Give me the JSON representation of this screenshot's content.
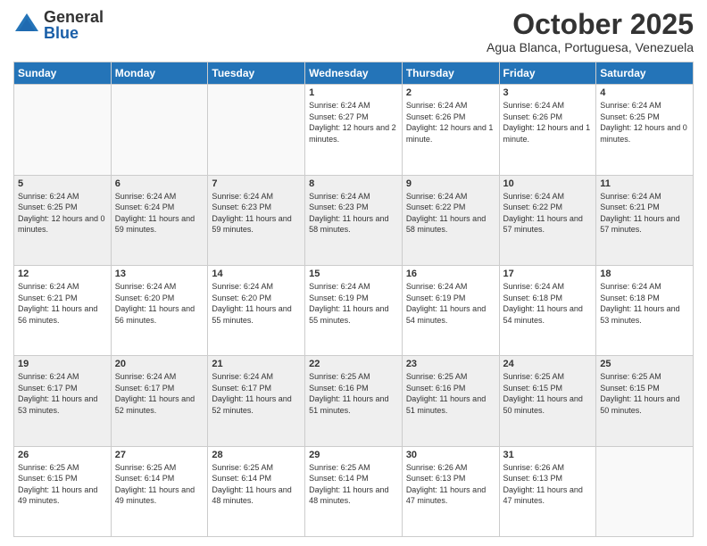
{
  "logo": {
    "general": "General",
    "blue": "Blue"
  },
  "header": {
    "month": "October 2025",
    "location": "Agua Blanca, Portuguesa, Venezuela"
  },
  "weekdays": [
    "Sunday",
    "Monday",
    "Tuesday",
    "Wednesday",
    "Thursday",
    "Friday",
    "Saturday"
  ],
  "weeks": [
    [
      {
        "day": "",
        "sunrise": "",
        "sunset": "",
        "daylight": ""
      },
      {
        "day": "",
        "sunrise": "",
        "sunset": "",
        "daylight": ""
      },
      {
        "day": "",
        "sunrise": "",
        "sunset": "",
        "daylight": ""
      },
      {
        "day": "1",
        "sunrise": "Sunrise: 6:24 AM",
        "sunset": "Sunset: 6:27 PM",
        "daylight": "Daylight: 12 hours and 2 minutes."
      },
      {
        "day": "2",
        "sunrise": "Sunrise: 6:24 AM",
        "sunset": "Sunset: 6:26 PM",
        "daylight": "Daylight: 12 hours and 1 minute."
      },
      {
        "day": "3",
        "sunrise": "Sunrise: 6:24 AM",
        "sunset": "Sunset: 6:26 PM",
        "daylight": "Daylight: 12 hours and 1 minute."
      },
      {
        "day": "4",
        "sunrise": "Sunrise: 6:24 AM",
        "sunset": "Sunset: 6:25 PM",
        "daylight": "Daylight: 12 hours and 0 minutes."
      }
    ],
    [
      {
        "day": "5",
        "sunrise": "Sunrise: 6:24 AM",
        "sunset": "Sunset: 6:25 PM",
        "daylight": "Daylight: 12 hours and 0 minutes."
      },
      {
        "day": "6",
        "sunrise": "Sunrise: 6:24 AM",
        "sunset": "Sunset: 6:24 PM",
        "daylight": "Daylight: 11 hours and 59 minutes."
      },
      {
        "day": "7",
        "sunrise": "Sunrise: 6:24 AM",
        "sunset": "Sunset: 6:23 PM",
        "daylight": "Daylight: 11 hours and 59 minutes."
      },
      {
        "day": "8",
        "sunrise": "Sunrise: 6:24 AM",
        "sunset": "Sunset: 6:23 PM",
        "daylight": "Daylight: 11 hours and 58 minutes."
      },
      {
        "day": "9",
        "sunrise": "Sunrise: 6:24 AM",
        "sunset": "Sunset: 6:22 PM",
        "daylight": "Daylight: 11 hours and 58 minutes."
      },
      {
        "day": "10",
        "sunrise": "Sunrise: 6:24 AM",
        "sunset": "Sunset: 6:22 PM",
        "daylight": "Daylight: 11 hours and 57 minutes."
      },
      {
        "day": "11",
        "sunrise": "Sunrise: 6:24 AM",
        "sunset": "Sunset: 6:21 PM",
        "daylight": "Daylight: 11 hours and 57 minutes."
      }
    ],
    [
      {
        "day": "12",
        "sunrise": "Sunrise: 6:24 AM",
        "sunset": "Sunset: 6:21 PM",
        "daylight": "Daylight: 11 hours and 56 minutes."
      },
      {
        "day": "13",
        "sunrise": "Sunrise: 6:24 AM",
        "sunset": "Sunset: 6:20 PM",
        "daylight": "Daylight: 11 hours and 56 minutes."
      },
      {
        "day": "14",
        "sunrise": "Sunrise: 6:24 AM",
        "sunset": "Sunset: 6:20 PM",
        "daylight": "Daylight: 11 hours and 55 minutes."
      },
      {
        "day": "15",
        "sunrise": "Sunrise: 6:24 AM",
        "sunset": "Sunset: 6:19 PM",
        "daylight": "Daylight: 11 hours and 55 minutes."
      },
      {
        "day": "16",
        "sunrise": "Sunrise: 6:24 AM",
        "sunset": "Sunset: 6:19 PM",
        "daylight": "Daylight: 11 hours and 54 minutes."
      },
      {
        "day": "17",
        "sunrise": "Sunrise: 6:24 AM",
        "sunset": "Sunset: 6:18 PM",
        "daylight": "Daylight: 11 hours and 54 minutes."
      },
      {
        "day": "18",
        "sunrise": "Sunrise: 6:24 AM",
        "sunset": "Sunset: 6:18 PM",
        "daylight": "Daylight: 11 hours and 53 minutes."
      }
    ],
    [
      {
        "day": "19",
        "sunrise": "Sunrise: 6:24 AM",
        "sunset": "Sunset: 6:17 PM",
        "daylight": "Daylight: 11 hours and 53 minutes."
      },
      {
        "day": "20",
        "sunrise": "Sunrise: 6:24 AM",
        "sunset": "Sunset: 6:17 PM",
        "daylight": "Daylight: 11 hours and 52 minutes."
      },
      {
        "day": "21",
        "sunrise": "Sunrise: 6:24 AM",
        "sunset": "Sunset: 6:17 PM",
        "daylight": "Daylight: 11 hours and 52 minutes."
      },
      {
        "day": "22",
        "sunrise": "Sunrise: 6:25 AM",
        "sunset": "Sunset: 6:16 PM",
        "daylight": "Daylight: 11 hours and 51 minutes."
      },
      {
        "day": "23",
        "sunrise": "Sunrise: 6:25 AM",
        "sunset": "Sunset: 6:16 PM",
        "daylight": "Daylight: 11 hours and 51 minutes."
      },
      {
        "day": "24",
        "sunrise": "Sunrise: 6:25 AM",
        "sunset": "Sunset: 6:15 PM",
        "daylight": "Daylight: 11 hours and 50 minutes."
      },
      {
        "day": "25",
        "sunrise": "Sunrise: 6:25 AM",
        "sunset": "Sunset: 6:15 PM",
        "daylight": "Daylight: 11 hours and 50 minutes."
      }
    ],
    [
      {
        "day": "26",
        "sunrise": "Sunrise: 6:25 AM",
        "sunset": "Sunset: 6:15 PM",
        "daylight": "Daylight: 11 hours and 49 minutes."
      },
      {
        "day": "27",
        "sunrise": "Sunrise: 6:25 AM",
        "sunset": "Sunset: 6:14 PM",
        "daylight": "Daylight: 11 hours and 49 minutes."
      },
      {
        "day": "28",
        "sunrise": "Sunrise: 6:25 AM",
        "sunset": "Sunset: 6:14 PM",
        "daylight": "Daylight: 11 hours and 48 minutes."
      },
      {
        "day": "29",
        "sunrise": "Sunrise: 6:25 AM",
        "sunset": "Sunset: 6:14 PM",
        "daylight": "Daylight: 11 hours and 48 minutes."
      },
      {
        "day": "30",
        "sunrise": "Sunrise: 6:26 AM",
        "sunset": "Sunset: 6:13 PM",
        "daylight": "Daylight: 11 hours and 47 minutes."
      },
      {
        "day": "31",
        "sunrise": "Sunrise: 6:26 AM",
        "sunset": "Sunset: 6:13 PM",
        "daylight": "Daylight: 11 hours and 47 minutes."
      },
      {
        "day": "",
        "sunrise": "",
        "sunset": "",
        "daylight": ""
      }
    ]
  ]
}
